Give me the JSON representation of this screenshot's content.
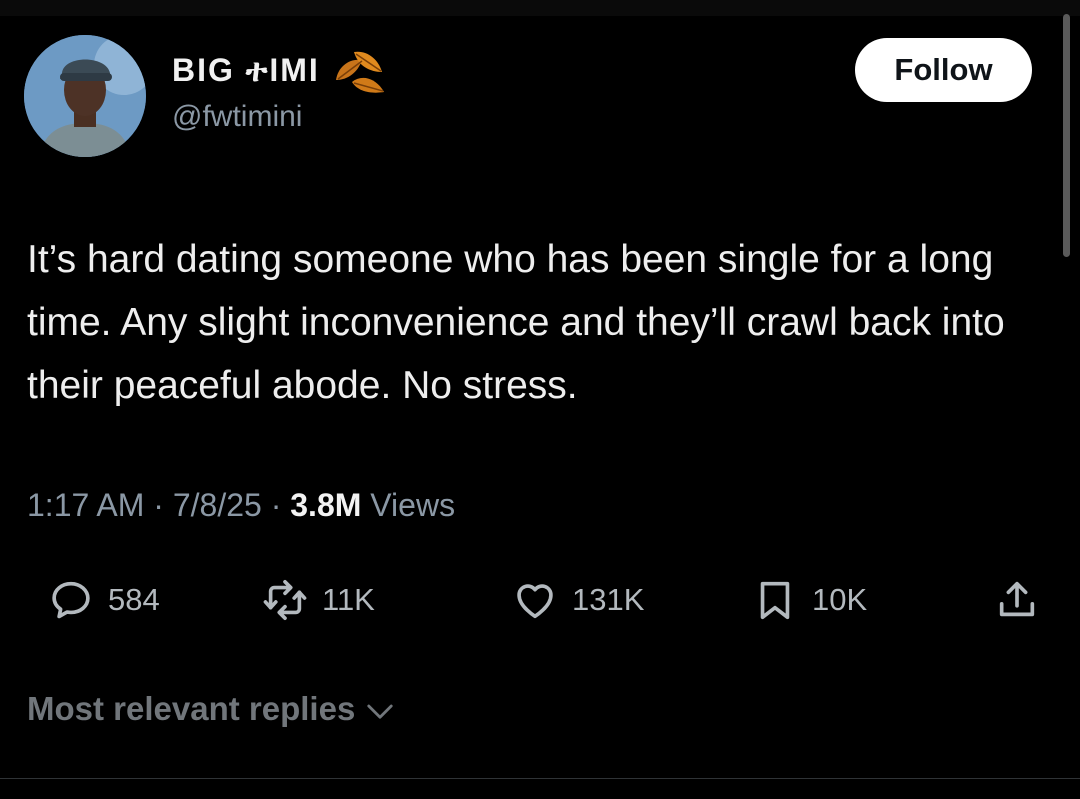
{
  "author": {
    "display_name": "BIG ተIMI",
    "handle": "@fwtimini",
    "follow_label": "Follow"
  },
  "tweet": {
    "text": "It’s hard dating someone who has been single for a long time. Any slight inconvenience and they’ll crawl back into their peaceful abode. No stress.",
    "time": "1:17 AM",
    "date": "7/8/25",
    "views_count": "3.8M",
    "views_label": "Views"
  },
  "actions": {
    "replies": "584",
    "reposts": "11K",
    "likes": "131K",
    "bookmarks": "10K"
  },
  "replies_sort": {
    "label": "Most relevant replies"
  },
  "colors": {
    "background": "#000000",
    "text": "#e7e9ea",
    "muted": "#8b98a5",
    "follow_bg": "#ffffff",
    "leaf_orange": "#e08a1e"
  }
}
